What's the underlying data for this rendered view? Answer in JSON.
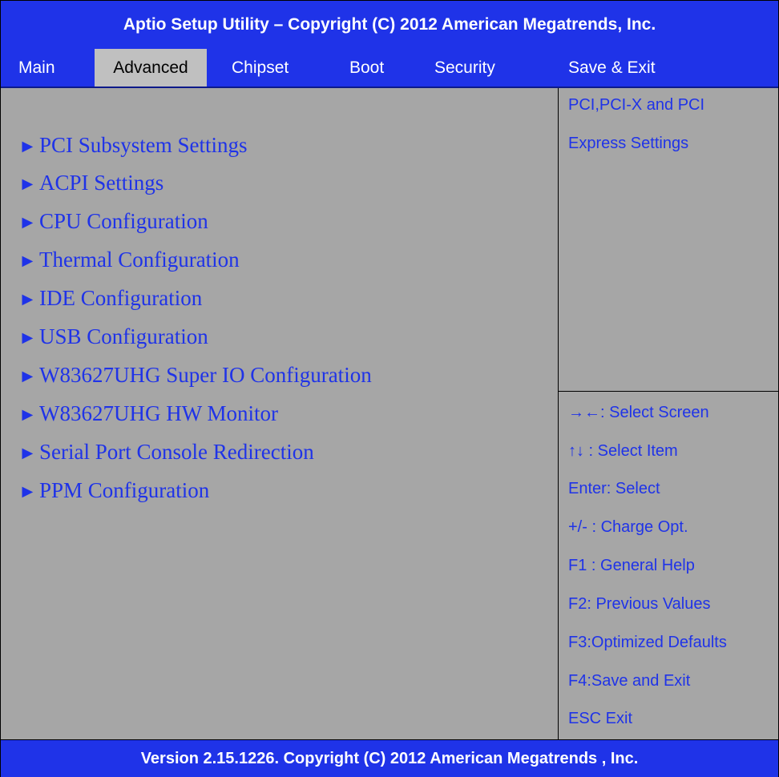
{
  "header": {
    "title": "Aptio Setup Utility – Copyright (C) 2012 American Megatrends, Inc."
  },
  "tabs": [
    {
      "label": "Main"
    },
    {
      "label": "Advanced"
    },
    {
      "label": "Chipset"
    },
    {
      "label": "Boot"
    },
    {
      "label": "Security"
    },
    {
      "label": "Save & Exit"
    }
  ],
  "active_tab": "Advanced",
  "menu": {
    "arrow_glyph": "►",
    "items": [
      {
        "label": "PCI Subsystem Settings"
      },
      {
        "label": "ACPI Settings"
      },
      {
        "label": "CPU Configuration"
      },
      {
        "label": "Thermal Configuration"
      },
      {
        "label": "IDE Configuration"
      },
      {
        "label": "USB Configuration"
      },
      {
        "label": "W83627UHG Super IO Configuration"
      },
      {
        "label": "W83627UHG HW Monitor"
      },
      {
        "label": "Serial Port Console Redirection"
      },
      {
        "label": "PPM Configuration"
      }
    ]
  },
  "help": {
    "lines": [
      "PCI,PCI-X and PCI",
      "Express Settings"
    ]
  },
  "keys": [
    "→←: Select Screen",
    "↑↓   : Select Item",
    "Enter:   Select",
    "+/- : Charge Opt.",
    "F1 : General Help",
    "F2: Previous Values",
    "F3:Optimized Defaults",
    "F4:Save and Exit",
    "ESC   Exit"
  ],
  "footer": {
    "text": "Version 2.15.1226. Copyright (C) 2012 American Megatrends , Inc."
  },
  "colors": {
    "title_bar": "#1f33e8",
    "panel": "#a6a6a6",
    "active_tab": "#c0c0c0",
    "item_text": "#1f33e8",
    "title_text": "#ffffff"
  }
}
